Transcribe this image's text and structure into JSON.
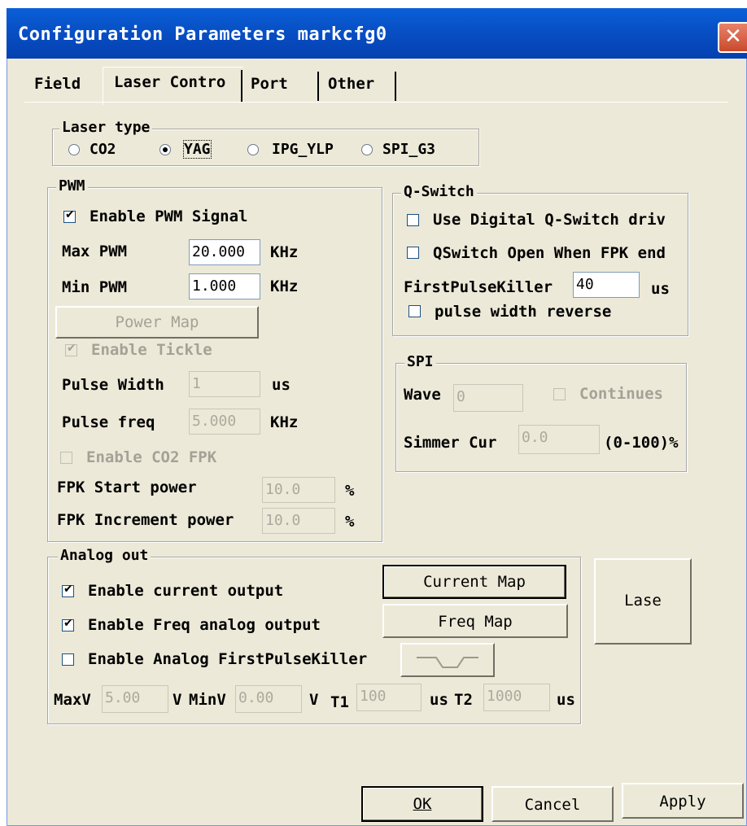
{
  "window": {
    "title": "Configuration Parameters markcfg0",
    "close_glyph": "✕"
  },
  "tabs": [
    {
      "label": "Field"
    },
    {
      "label": "Laser Contro"
    },
    {
      "label": "Port"
    },
    {
      "label": "Other"
    }
  ],
  "laser_type": {
    "legend": "Laser type",
    "options": [
      "CO2",
      "YAG",
      "IPG_YLP",
      "SPI_G3"
    ],
    "selected": "YAG"
  },
  "pwm": {
    "legend": "PWM",
    "enable_pwm": "Enable PWM Signal",
    "max_pwm_label": "Max PWM",
    "max_pwm_value": "20.000",
    "max_pwm_unit": "KHz",
    "min_pwm_label": "Min PWM",
    "min_pwm_value": "1.000",
    "min_pwm_unit": "KHz",
    "power_map": "Power Map",
    "enable_tickle": "Enable Tickle",
    "pulse_width_label": "Pulse Width",
    "pulse_width_value": "1",
    "pulse_width_unit": "us",
    "pulse_freq_label": "Pulse freq",
    "pulse_freq_value": "5.000",
    "pulse_freq_unit": "KHz",
    "enable_co2_fpk": "Enable CO2 FPK",
    "fpk_start_label": "FPK Start power",
    "fpk_start_value": "10.0",
    "fpk_start_unit": "%",
    "fpk_inc_label": "FPK Increment power",
    "fpk_inc_value": "10.0",
    "fpk_inc_unit": "%"
  },
  "qswitch": {
    "legend": "Q-Switch",
    "use_digital": "Use Digital Q-Switch driv",
    "open_when_fpk": "QSwitch Open When FPK end",
    "fpk_label": "FirstPulseKiller",
    "fpk_value": "40",
    "fpk_unit": "us",
    "pulse_reverse": "pulse width reverse"
  },
  "spi": {
    "legend": "SPI",
    "wave_label": "Wave",
    "wave_value": "0",
    "continues": "Continues",
    "simmer_label": "Simmer Cur",
    "simmer_value": "0.0",
    "simmer_unit": "(0-100)%"
  },
  "analog": {
    "legend": "Analog out",
    "enable_current": "Enable current output",
    "enable_freq": "Enable Freq analog output",
    "enable_fpk": "Enable Analog FirstPulseKiller",
    "current_map": "Current Map",
    "freq_map": "Freq Map",
    "maxv_label": "MaxV",
    "maxv_value": "5.00",
    "v1": "V",
    "minv_label": "MinV",
    "minv_value": "0.00",
    "v2": "V",
    "t1_label": "T1",
    "t1_value": "100",
    "us1": "us",
    "t2_label": "T2",
    "t2_value": "1000",
    "us2": "us"
  },
  "lase": "Lase",
  "footer": {
    "ok": "OK",
    "cancel": "Cancel",
    "apply": "Apply"
  }
}
